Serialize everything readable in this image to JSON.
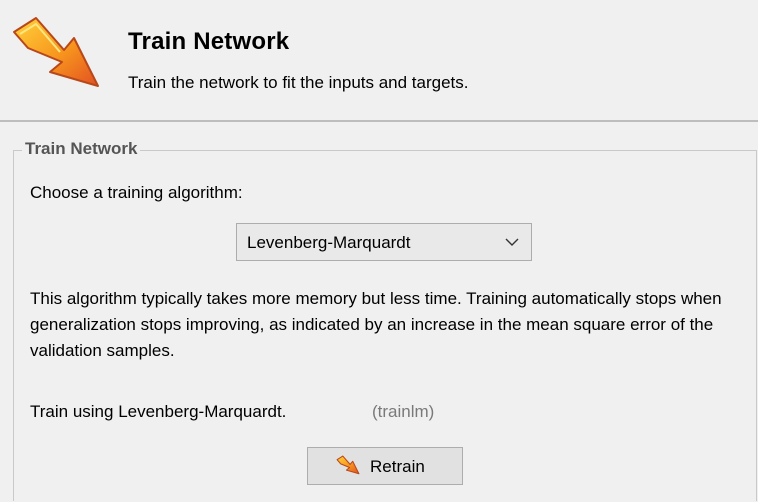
{
  "header": {
    "title": "Train Network",
    "subtitle": "Train the network to fit the inputs and targets.",
    "icon": "train-arrow-icon"
  },
  "group": {
    "title": "Train Network",
    "choose_label": "Choose a training algorithm:",
    "algorithm": {
      "selected": "Levenberg-Marquardt",
      "icon": "chevron-down-icon"
    },
    "description": "This algorithm typically takes more memory but less time. Training automatically stops when generalization stops improving, as indicated by an increase in the mean square error of the validation samples.",
    "train_using": "Train using Levenberg-Marquardt.",
    "train_code": "(trainlm)",
    "retrain": {
      "label": "Retrain",
      "icon": "train-arrow-icon"
    }
  },
  "colors": {
    "icon_orange": "#f7941d",
    "icon_red": "#e25022",
    "panel_bg": "#f0f0f0",
    "muted_text": "#7a7a7a"
  }
}
